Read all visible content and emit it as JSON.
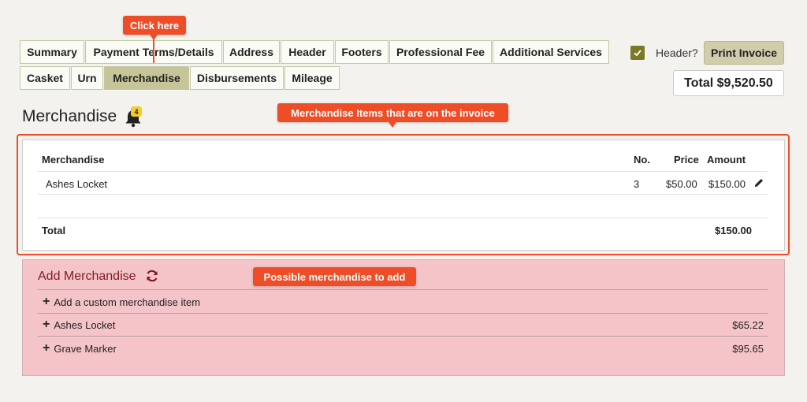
{
  "tabs_row1": [
    "Summary",
    "Payment Terms/Details",
    "Address",
    "Header",
    "Footers",
    "Professional Fee",
    "Additional Services"
  ],
  "tabs_row2": [
    "Casket",
    "Urn",
    "Merchandise",
    "Disbursements",
    "Mileage"
  ],
  "active_tab": "Merchandise",
  "callouts": {
    "click_here": "Click here",
    "items_on_invoice": "Merchandise Items that are on the invoice",
    "possible_add": "Possible merchandise to add"
  },
  "header_toggle": {
    "label": "Header?",
    "checked": true
  },
  "print_button": "Print Invoice",
  "invoice_total": "Total $9,520.50",
  "section": {
    "title": "Merchandise",
    "notification_count": "4",
    "bell_icon": "bell-icon"
  },
  "table": {
    "headers": {
      "item": "Merchandise",
      "no": "No.",
      "price": "Price",
      "amount": "Amount"
    },
    "rows": [
      {
        "item": "Ashes Locket",
        "no": "3",
        "price": "$50.00",
        "amount": "$150.00",
        "action_icon": "pencil-icon"
      }
    ],
    "footer": {
      "label": "Total",
      "amount": "$150.00"
    }
  },
  "add_merchandise": {
    "title": "Add Merchandise",
    "refresh_icon": "refresh-icon",
    "items": [
      {
        "label": "Add a custom merchandise item",
        "price": ""
      },
      {
        "label": "Ashes Locket",
        "price": "$65.22"
      },
      {
        "label": "Grave Marker",
        "price": "$95.65"
      }
    ]
  },
  "colors": {
    "accent": "#ef4d27",
    "tab_active": "#c6c59a",
    "add_panel": "#f5c4c8",
    "checkbox": "#7b7925"
  }
}
